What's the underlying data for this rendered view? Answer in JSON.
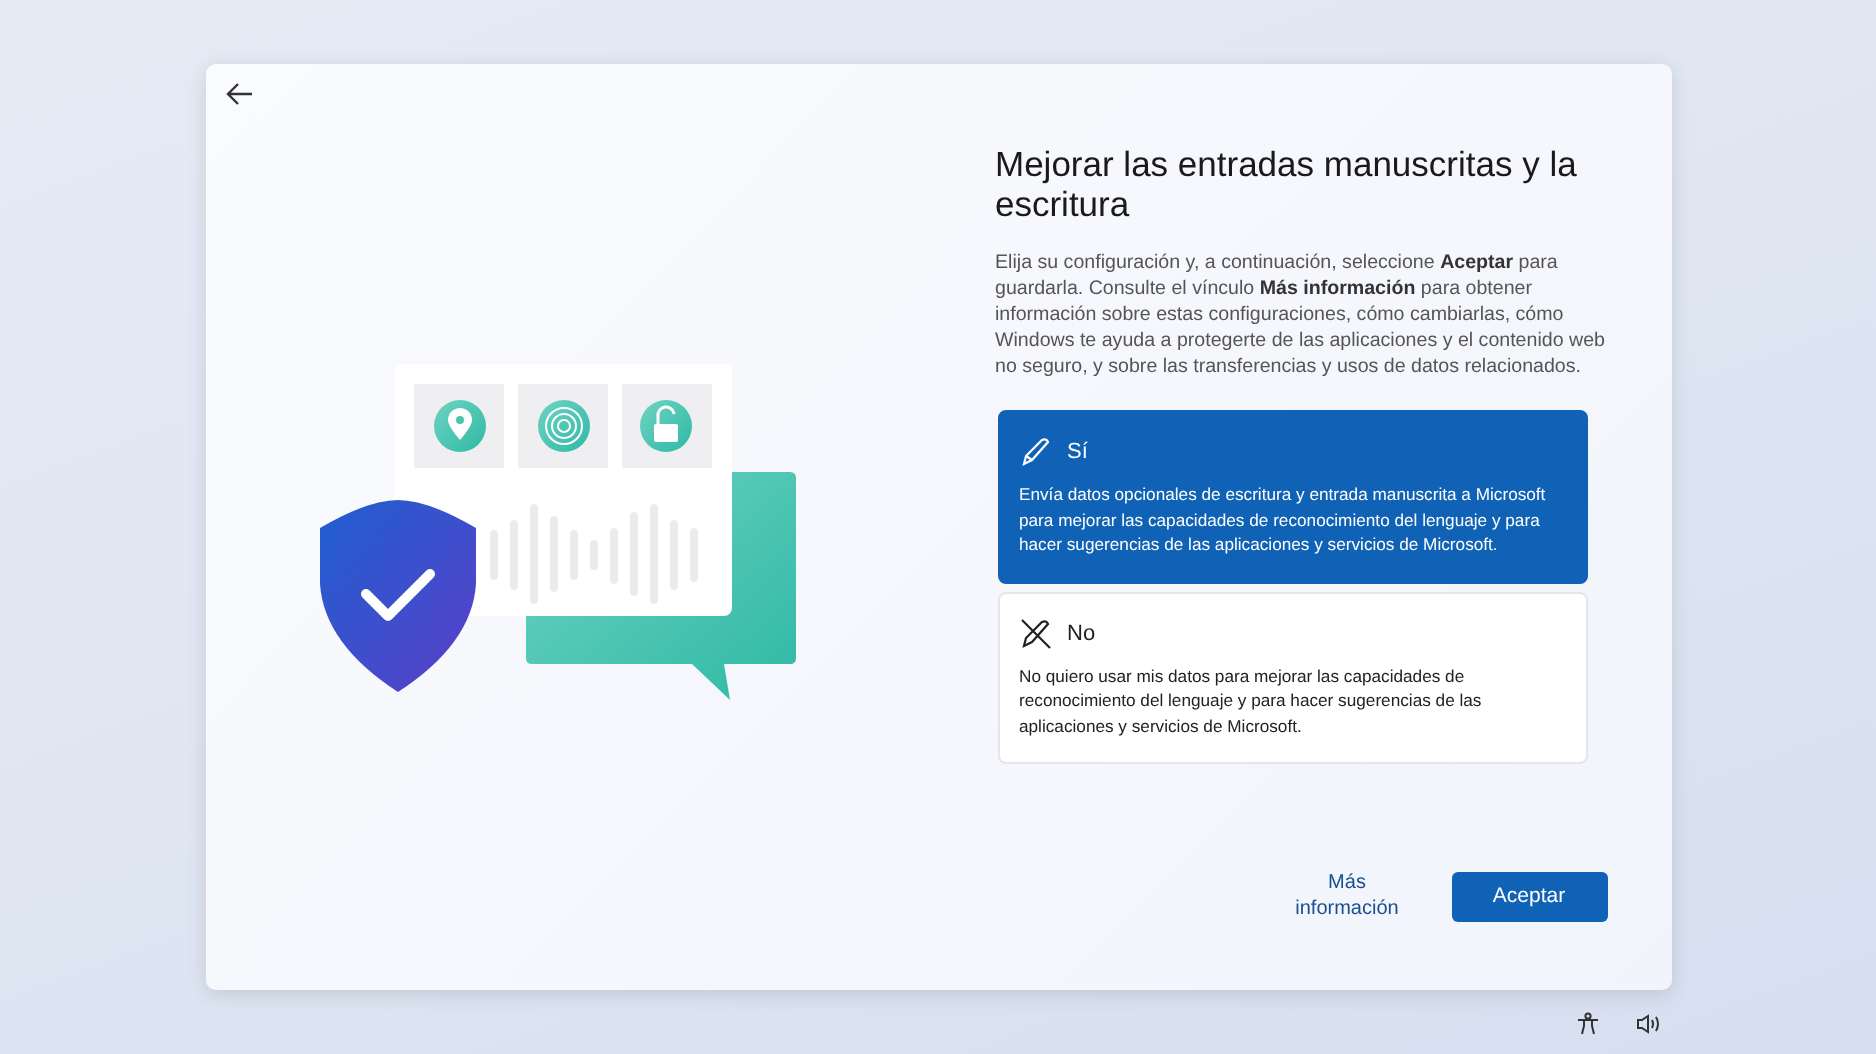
{
  "title": "Mejorar las entradas manuscritas y la escritura",
  "description": "Elija su configuración y, a continuación, seleccione **Aceptar** para guardarla. Consulte el vínculo **Más información** para obtener información sobre estas configuraciones, cómo cambiarlas, cómo Windows te ayuda a protegerte de las aplicaciones y el contenido web no seguro, y sobre las transferencias y usos de datos relacionados.",
  "options": [
    {
      "kind": "yes",
      "label": "Sí",
      "text": "Envía datos opcionales de escritura y entrada manuscrita a Microsoft para mejorar las capacidades de reconocimiento del lenguaje y para hacer sugerencias de las aplicaciones y servicios de Microsoft.",
      "selected": true
    },
    {
      "kind": "no",
      "label": "No",
      "text": "No quiero usar mis datos para mejorar las capacidades de reconocimiento del lenguaje y para hacer sugerencias de las aplicaciones y servicios de Microsoft.",
      "selected": false
    }
  ],
  "more_info_link": "Más información",
  "accept_button": "Aceptar"
}
